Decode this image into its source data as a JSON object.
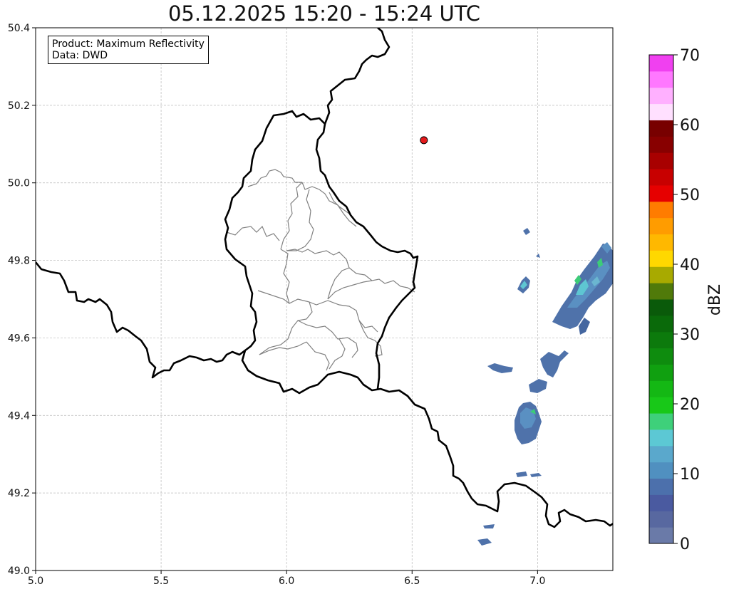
{
  "title": "05.12.2025 15:20 - 15:24 UTC",
  "info": {
    "product": "Product: Maximum Reflectivity",
    "data": "Data: DWD"
  },
  "map": {
    "lon_range": [
      5.0,
      7.3
    ],
    "lat_range": [
      49.0,
      50.4
    ],
    "x_ticks": [
      5.0,
      5.5,
      6.0,
      6.5,
      7.0
    ],
    "x_tick_labels": [
      "5.0",
      "5.5",
      "6.0",
      "6.5",
      "7.0"
    ],
    "y_ticks": [
      49.0,
      49.2,
      49.4,
      49.6,
      49.8,
      50.0,
      50.2,
      50.4
    ],
    "y_tick_labels": [
      "49.0",
      "49.2",
      "49.4",
      "49.6",
      "49.8",
      "50.0",
      "50.2",
      "50.4"
    ],
    "grid": true,
    "marker": {
      "lon": 6.547,
      "lat": 50.11,
      "color": "#e41a1c"
    }
  },
  "colorbar": {
    "label": "dBZ",
    "ticks": [
      0,
      10,
      20,
      30,
      40,
      50,
      60,
      70
    ],
    "tick_labels": [
      "0",
      "10",
      "20",
      "30",
      "40",
      "50",
      "60",
      "70"
    ],
    "colors": [
      "#6a7aa8",
      "#5868a0",
      "#4a5aa0",
      "#4c70ac",
      "#5090c0",
      "#5aa8cc",
      "#5cc8d4",
      "#3ed07a",
      "#18c818",
      "#14b814",
      "#10a010",
      "#0e8c0e",
      "#0c7a0c",
      "#0a6a0a",
      "#0a5a0a",
      "#507a0a",
      "#a8aa00",
      "#ffd800",
      "#ffb800",
      "#ff9c00",
      "#ff7c00",
      "#e60000",
      "#c80000",
      "#a80000",
      "#880000",
      "#780000",
      "#ffe0ff",
      "#ffb0ff",
      "#ff78ff",
      "#f040f0"
    ]
  }
}
